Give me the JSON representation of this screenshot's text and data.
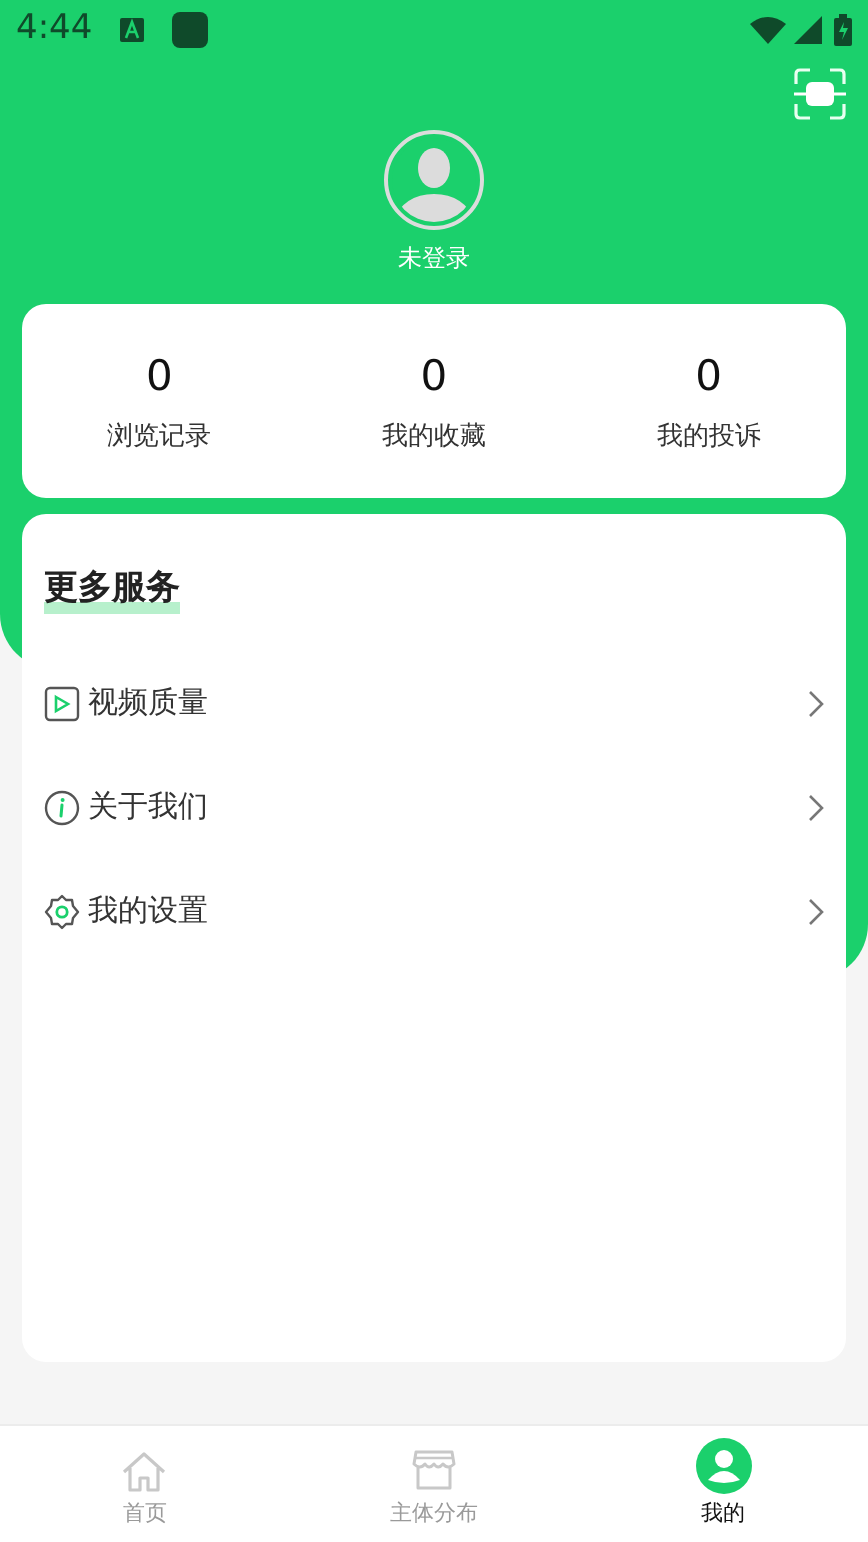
{
  "status_bar": {
    "time": "4:44"
  },
  "profile": {
    "name": "未登录"
  },
  "stats": [
    {
      "value": "0",
      "label": "浏览记录"
    },
    {
      "value": "0",
      "label": "我的收藏"
    },
    {
      "value": "0",
      "label": "我的投诉"
    }
  ],
  "services": {
    "title": "更多服务",
    "items": [
      {
        "kind": "video",
        "label": "视频质量"
      },
      {
        "kind": "info",
        "label": "关于我们"
      },
      {
        "kind": "settings",
        "label": "我的设置"
      }
    ]
  },
  "tab_bar": [
    {
      "kind": "home",
      "label": "首页",
      "selected": false
    },
    {
      "kind": "store",
      "label": "主体分布",
      "selected": false
    },
    {
      "kind": "user",
      "label": "我的",
      "selected": true
    }
  ]
}
